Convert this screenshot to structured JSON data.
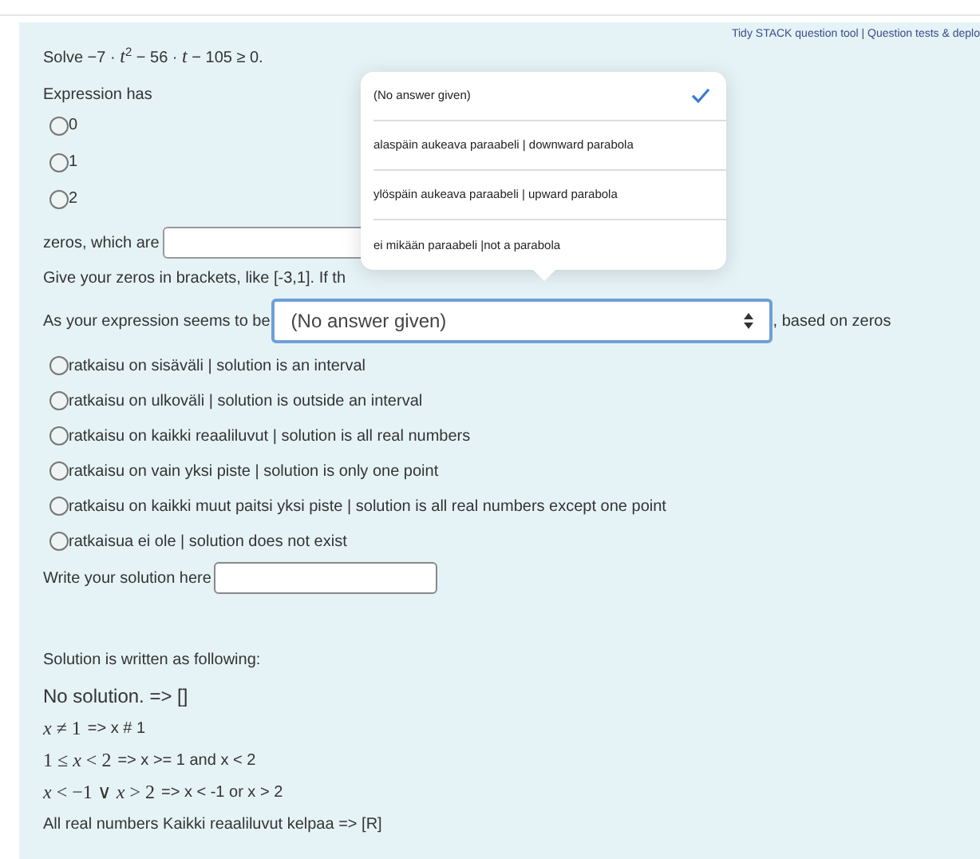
{
  "header_link": "Tidy STACK question tool | Question tests & deplo",
  "question": "Solve −7 · *t*$^{2}$ − 56 · *t* − 105 ≥ 0.",
  "zeros_prompt": "Expression has",
  "zero_options": [
    {
      "label": "0",
      "selected": false
    },
    {
      "label": "1",
      "selected": false
    },
    {
      "label": "2",
      "selected": false
    }
  ],
  "zeros_field": {
    "label": "zeros, which are"
  },
  "zeros_hint": "Give your zeros in brackets, like [-3,1]. If th",
  "shape_prompt": "As your expression seems to be",
  "shape_select": {
    "value": "(No answer given)",
    "suffix": ", based on zeros"
  },
  "dropdown": {
    "expanded": true,
    "options": [
      {
        "label": "(No answer given)",
        "selected": true
      },
      {
        "label": "alaspäin aukeava paraabeli | downward parabola",
        "selected": false
      },
      {
        "label": "ylöspäin aukeava paraabeli | upward parabola",
        "selected": false
      },
      {
        "label": "ei mikään paraabeli |not a parabola",
        "selected": false
      }
    ]
  },
  "solution_options": [
    {
      "label": "ratkaisu on sisäväli | solution is an interval",
      "selected": false
    },
    {
      "label": "ratkaisu on ulkoväli | solution is outside an interval",
      "selected": false
    },
    {
      "label": "ratkaisu on kaikki reaaliluvut | solution is all real numbers",
      "selected": false
    },
    {
      "label": "ratkaisu on vain yksi piste | solution is only one point",
      "selected": false
    },
    {
      "label": "ratkaisu on kaikki muut paitsi yksi piste | solution is all real numbers except one point",
      "selected": false
    },
    {
      "label": "ratkaisua ei ole | solution does not exist",
      "selected": false
    }
  ],
  "solution_field": {
    "label": "Write your solution here"
  },
  "format_heading": "Solution is written as following:",
  "format_examples": [
    {
      "kind": "plain",
      "text": "No solution. => []"
    },
    {
      "kind": "math",
      "math": "*x* ≠ 1",
      "text": "=> x # 1"
    },
    {
      "kind": "math",
      "math": "1 ≤ *x* < 2",
      "text": "=> x >= 1 and x < 2"
    },
    {
      "kind": "math",
      "math": "*x* < −1 ∨ *x* > 2",
      "text": "=> x < -1 or x > 2"
    },
    {
      "kind": "small",
      "text": "All real numbers Kaikki reaaliluvut kelpaa => [R]"
    }
  ]
}
